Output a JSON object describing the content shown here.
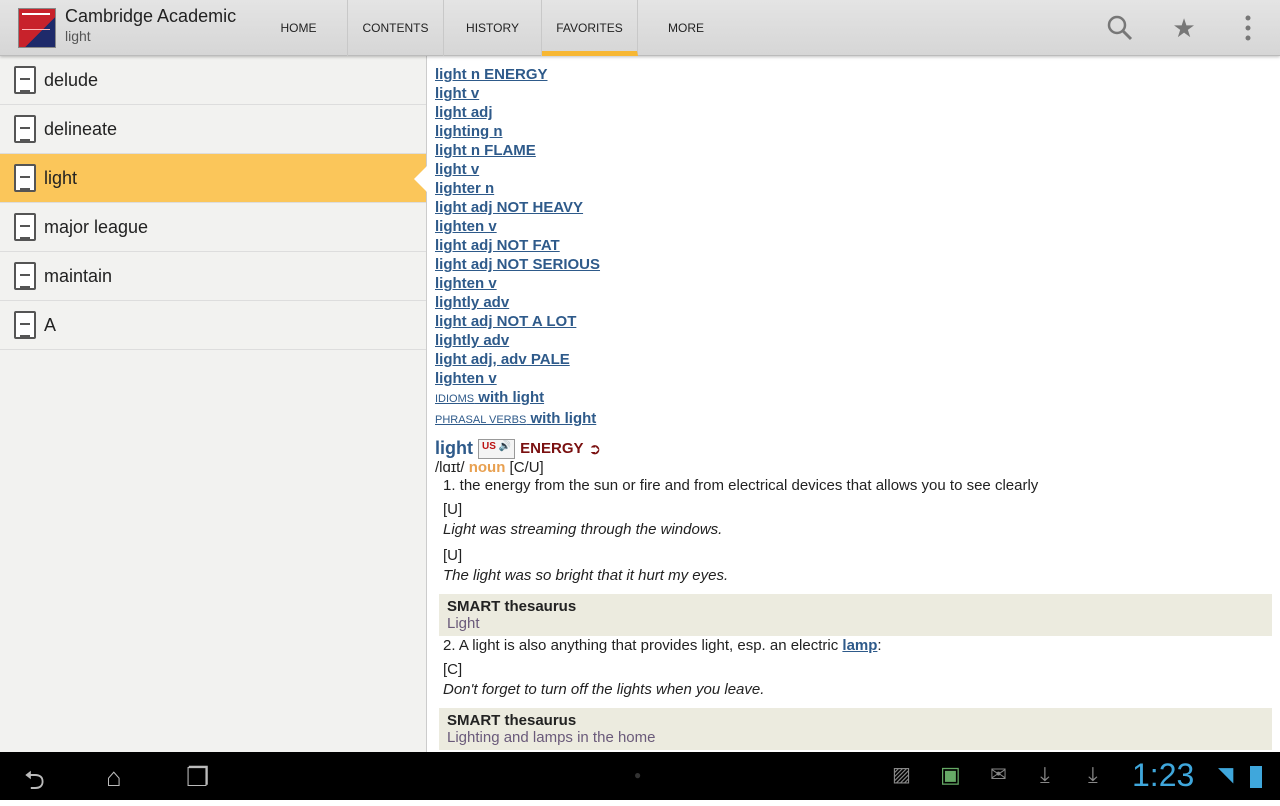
{
  "header": {
    "app_title": "Cambridge Academic",
    "subtitle": "light",
    "tabs": [
      "HOME",
      "CONTENTS",
      "HISTORY",
      "FAVORITES",
      "MORE"
    ],
    "active_tab": "FAVORITES",
    "icons": [
      "search-icon",
      "star-icon",
      "overflow-menu-icon"
    ]
  },
  "sidebar": {
    "items": [
      "delude",
      "delineate",
      "light",
      "major league",
      "maintain",
      "A"
    ],
    "selected": "light"
  },
  "content": {
    "links": [
      "light n ENERGY",
      "light v",
      "light adj",
      "lighting n",
      "light n FLAME",
      "light v",
      "lighter n",
      "light adj NOT HEAVY",
      "lighten v",
      "light adj NOT FAT",
      "light adj NOT SERIOUS",
      "lighten v",
      "lightly adv",
      "light adj NOT A LOT",
      "lightly adv",
      "light adj, adv PALE",
      "lighten v"
    ],
    "idioms": {
      "label": "idioms",
      "text": " with light"
    },
    "phrasal": {
      "label": "phrasal verbs",
      "text": " with light"
    },
    "entry": {
      "headword": "light",
      "us_label": "US",
      "sense": "ENERGY",
      "pron": "/lɑɪt/",
      "pos": "noun",
      "gram": "[C/U]",
      "def1": "1. the energy from the sun or fire and from electrical devices that allows you to see clearly",
      "ex1_gram": "[U]",
      "ex1": "Light was streaming through the windows.",
      "ex2_gram": "[U]",
      "ex2": "The light was so bright that it hurt my eyes.",
      "thes1_title": "SMART thesaurus",
      "thes1": "Light",
      "def2_pre": "2. A light is also anything that provides light, esp. an electric ",
      "def2_link": "lamp",
      "def2_post": ":",
      "ex3_gram": "[C]",
      "ex3": "Don't forget to turn off the lights when you leave.",
      "thes2_title": "SMART thesaurus",
      "thes2": "Lighting and lamps in the home"
    }
  },
  "statusbar": {
    "time": "1:23"
  },
  "colors": {
    "accent": "#f7b733",
    "link": "#2e5a8a",
    "selected": "#fbc65a",
    "clock": "#3fa7dc"
  }
}
